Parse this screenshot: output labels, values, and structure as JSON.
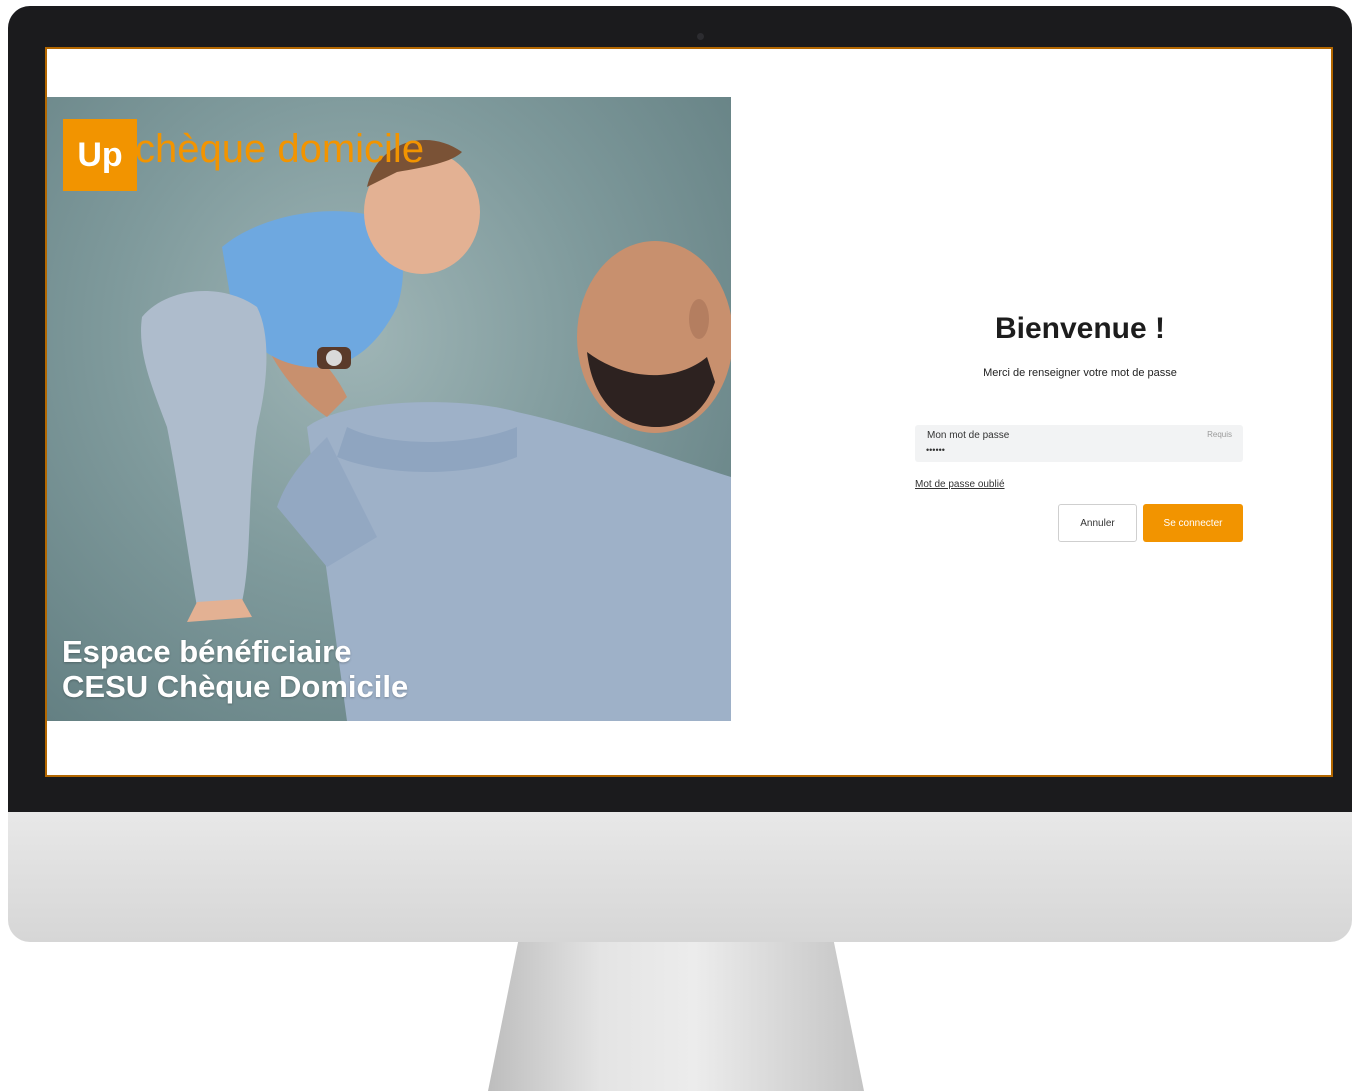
{
  "hero": {
    "logo_mark": "Up",
    "logo_text": "chèque domicile",
    "title_line1": "Espace bénéficiaire",
    "title_line2": "CESU Chèque Domicile"
  },
  "login": {
    "title": "Bienvenue !",
    "subtitle": "Merci de renseigner votre mot de passe",
    "password_label": "Mon mot de passe",
    "password_required": "Requis",
    "password_value": "••••••",
    "forgot_link": "Mot de passe oublié",
    "cancel_label": "Annuler",
    "submit_label": "Se connecter"
  },
  "colors": {
    "brand_orange": "#f29400",
    "field_background": "#f2f3f4",
    "bezel": "#1b1b1d"
  }
}
